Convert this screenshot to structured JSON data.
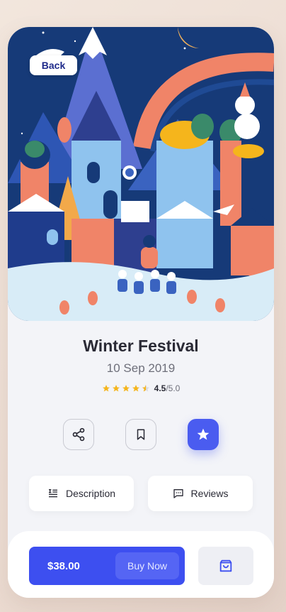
{
  "header": {
    "back_label": "Back"
  },
  "event": {
    "title": "Winter Festival",
    "date": "10 Sep 2019",
    "rating": "4.5",
    "rating_max": "/5.0",
    "stars_filled": 4.5
  },
  "tabs": [
    {
      "label": "Description",
      "icon": "description-icon"
    },
    {
      "label": "Reviews",
      "icon": "chat-icon"
    }
  ],
  "actions": [
    {
      "icon": "share-icon"
    },
    {
      "icon": "bookmark-icon"
    },
    {
      "icon": "star-icon"
    }
  ],
  "purchase": {
    "price": "$38.00",
    "buy_label": "Buy Now",
    "cart_icon": "cart-icon"
  },
  "colors": {
    "accent": "#3d4ff0",
    "star": "#f5b51c",
    "title": "#2a2a35"
  }
}
